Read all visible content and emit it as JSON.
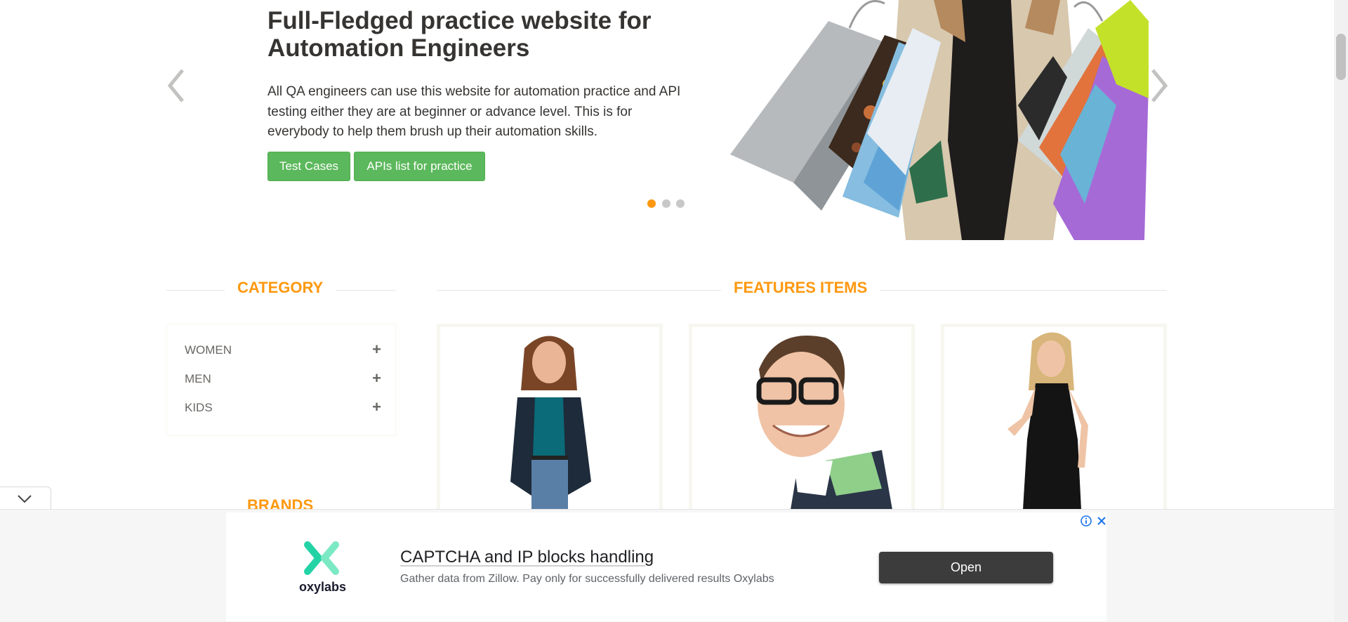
{
  "slider": {
    "title": "Full-Fledged practice website for Automation Engineers",
    "description": "All QA engineers can use this website for automation practice and API testing either they are at beginner or advance level. This is for everybody to help them brush up their automation skills.",
    "buttons": {
      "test_cases": "Test Cases",
      "apis": "APIs list for practice"
    },
    "active_slide": 1,
    "slide_count": 3
  },
  "category": {
    "title": "CATEGORY",
    "items": [
      {
        "label": "WOMEN",
        "toggle": "+"
      },
      {
        "label": "MEN",
        "toggle": "+"
      },
      {
        "label": "KIDS",
        "toggle": "+"
      }
    ]
  },
  "brands": {
    "title": "BRANDS"
  },
  "features": {
    "title": "FEATURES ITEMS"
  },
  "ad": {
    "brand": "oxylabs",
    "title": "CAPTCHA and IP blocks handling",
    "subtitle": "Gather data from Zillow. Pay only for successfully delivered results Oxylabs",
    "open_label": "Open",
    "info_icon": "info-icon",
    "close_icon": "close-icon"
  },
  "colors": {
    "accent": "#fe980f",
    "button_green": "#5cb85c",
    "text": "#363432",
    "ad_button": "#3c3c3c"
  }
}
